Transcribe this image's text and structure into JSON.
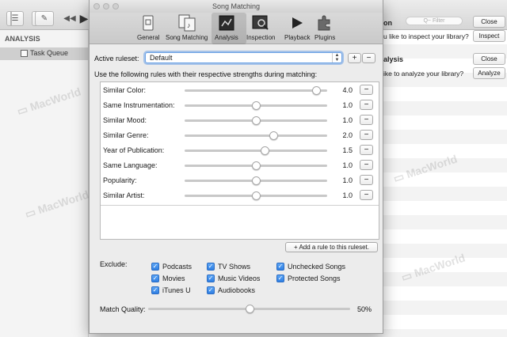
{
  "background": {
    "sidebar": {
      "section": "ANALYSIS",
      "item": "Task Queue"
    },
    "panels": [
      {
        "title": "on",
        "text": "u like to inspect your library?",
        "close": "Close",
        "action": "Inspect"
      },
      {
        "title": "alysis",
        "text": "ike to analyze your library?",
        "close": "Close",
        "action": "Analyze"
      }
    ],
    "filter_placeholder": "Q~ Filter"
  },
  "dialog": {
    "title": "Song Matching",
    "toolbar": [
      {
        "label": "General",
        "icon": "general-icon"
      },
      {
        "label": "Song Matching",
        "icon": "song-matching-icon"
      },
      {
        "label": "Analysis",
        "icon": "analysis-icon",
        "selected": true
      },
      {
        "label": "Inspection",
        "icon": "inspection-icon"
      },
      {
        "label": "Playback",
        "icon": "playback-icon"
      },
      {
        "label": "Plugins",
        "icon": "plugins-icon"
      }
    ],
    "active_ruleset_label": "Active ruleset:",
    "active_ruleset_value": "Default",
    "add_ruleset": "+",
    "remove_ruleset": "−",
    "rules_heading": "Use the following rules with their respective strengths during matching:",
    "rules": [
      {
        "label": "Similar Color:",
        "value": "4.0",
        "level": 0.92
      },
      {
        "label": "Same Instrumentation:",
        "value": "1.0",
        "level": 0.5
      },
      {
        "label": "Similar Mood:",
        "value": "1.0",
        "level": 0.5
      },
      {
        "label": "Similar Genre:",
        "value": "2.0",
        "level": 0.62
      },
      {
        "label": "Year of Publication:",
        "value": "1.5",
        "level": 0.56
      },
      {
        "label": "Same Language:",
        "value": "1.0",
        "level": 0.5
      },
      {
        "label": "Popularity:",
        "value": "1.0",
        "level": 0.5
      },
      {
        "label": "Similar Artist:",
        "value": "1.0",
        "level": 0.5
      }
    ],
    "remove_rule": "−",
    "add_rule_button": "+ Add a rule to this ruleset.",
    "exclude_label": "Exclude:",
    "exclude": {
      "col1": [
        "Podcasts",
        "Movies",
        "iTunes U"
      ],
      "col2": [
        "TV Shows",
        "Music Videos",
        "Audiobooks"
      ],
      "col3": [
        "Unchecked Songs",
        "Protected Songs"
      ]
    },
    "match_quality_label": "Match Quality:",
    "match_quality_value": "50%",
    "match_quality_level": 0.5
  },
  "colors": {
    "accent": "#2f7fe3",
    "focus_ring": "#6ba2e6"
  }
}
